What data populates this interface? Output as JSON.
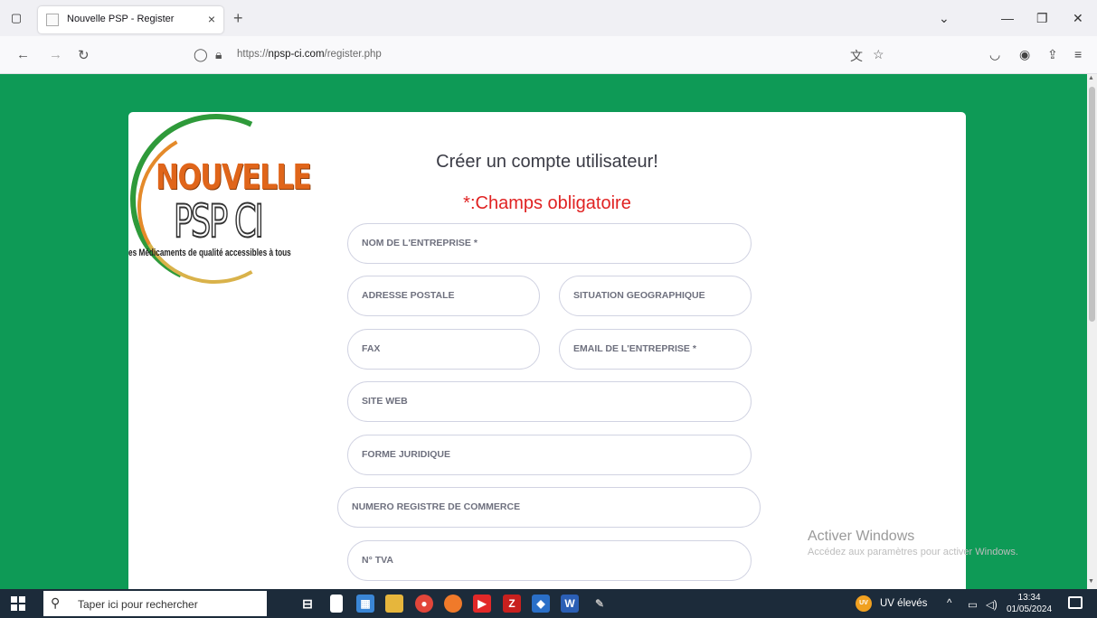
{
  "browser": {
    "tab_title": "Nouvelle PSP - Register",
    "tab_close": "×",
    "new_tab": "+",
    "url_prefix": "https://",
    "url_domain": "npsp-ci.com",
    "url_path": "/register.php"
  },
  "logo": {
    "line1": "NOUVELLE",
    "line2": "PSP CI",
    "tagline": "es Médicaments de qualité accessibles à tous"
  },
  "form": {
    "title": "Créer un compte utilisateur!",
    "required_note": "*:Champs obligatoire",
    "fields": [
      "NOM DE L'ENTREPRISE *",
      "ADRESSE POSTALE",
      "SITUATION GEOGRAPHIQUE",
      "FAX",
      "EMAIL  DE L'ENTREPRISE *",
      "SITE WEB",
      "FORME JURIDIQUE",
      "NUMERO REGISTRE DE COMMERCE",
      "N° TVA"
    ]
  },
  "watermark": {
    "line1": "Activer Windows",
    "line2": "Accédez aux paramètres pour activer Windows."
  },
  "taskbar": {
    "search_placeholder": "Taper ici pour rechercher",
    "user_label": "UV élevés",
    "time": "13:34",
    "date": "01/05/2024"
  },
  "colors": {
    "page_background": "#0e9a56",
    "required_text": "#e02222",
    "taskbar": "#1c2b3a"
  }
}
